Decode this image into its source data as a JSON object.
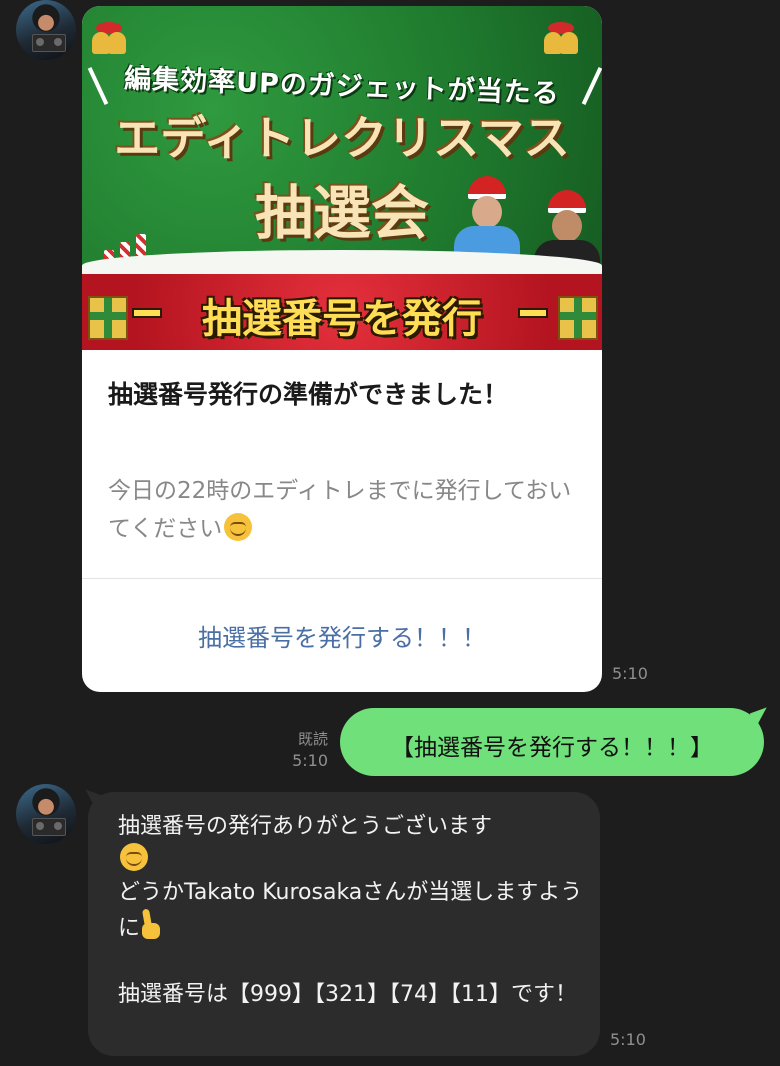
{
  "banner": {
    "subtitle": "編集効率UPのガジェットが当たる",
    "title_line1": "エディトレクリスマス",
    "title_line2": "抽選会",
    "ribbon_text": "抽選番号を発行"
  },
  "card": {
    "headline": "抽選番号発行の準備ができました！",
    "description": "今日の22時のエディトレまでに発行しておいてください",
    "action_label": "抽選番号を発行する！！！",
    "time": "5:10"
  },
  "outgoing": {
    "text": "【抽選番号を発行する！！！】",
    "read_label": "既読",
    "time": "5:10",
    "bubble_color": "#6fe07a"
  },
  "incoming": {
    "line1": "抽選番号の発行ありがとうございます",
    "line2a": "どうか",
    "name": "Takato Kurosaka",
    "line2b": "さんが当選しますように",
    "line3": "抽選番号は【999】【321】【74】【11】です！",
    "time": "5:10"
  },
  "icons": [
    "avatar",
    "smile-emoji",
    "crossed-fingers-emoji",
    "bell-icon",
    "gift-icon"
  ]
}
